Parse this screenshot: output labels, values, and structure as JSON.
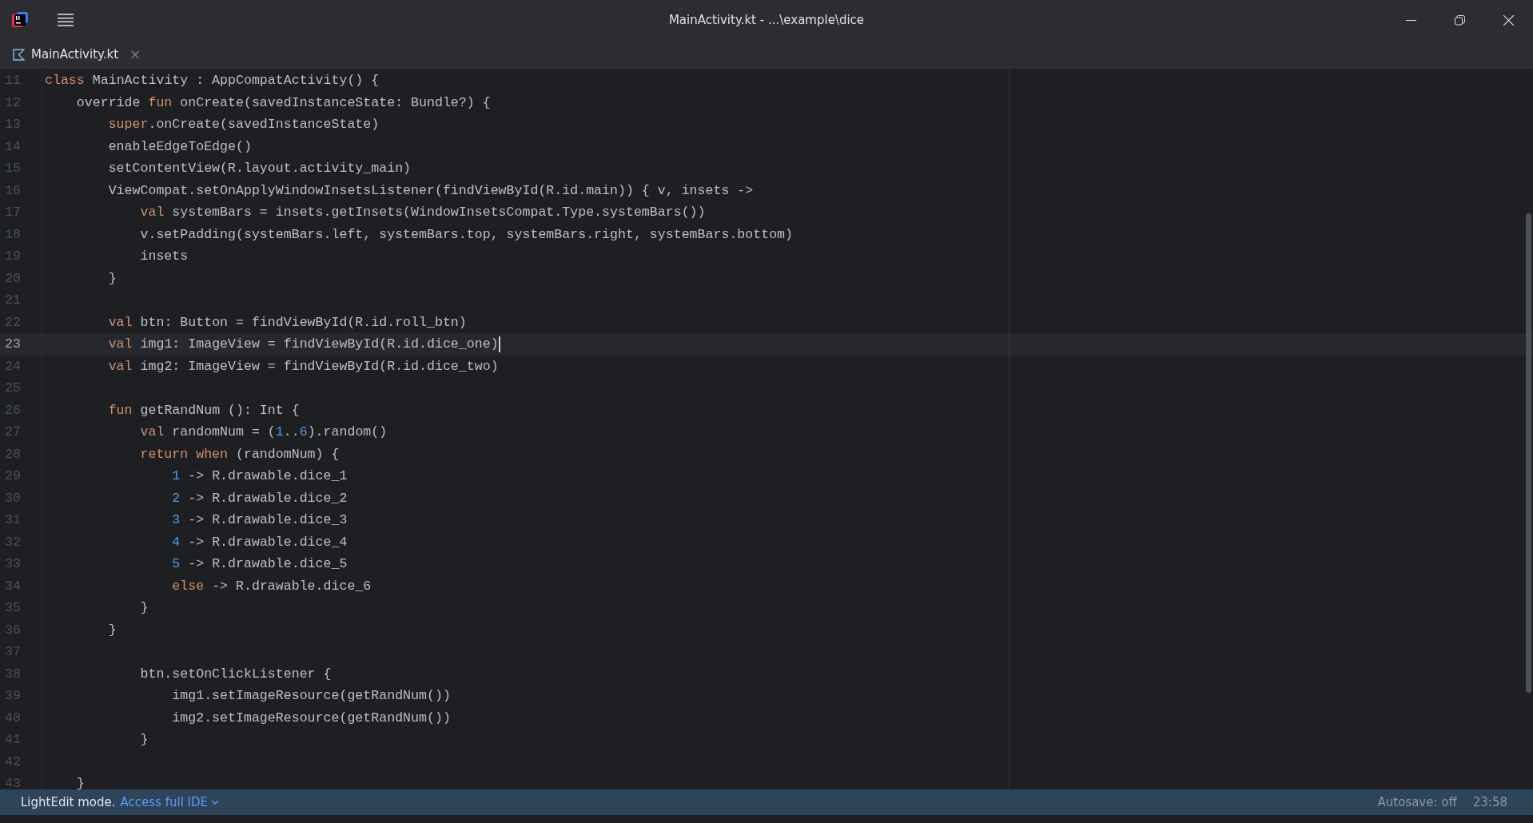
{
  "window": {
    "title": "MainActivity.kt - ...\\example\\dice"
  },
  "tabs": [
    {
      "label": "MainActivity.kt",
      "selected": true,
      "close": "×"
    }
  ],
  "editor": {
    "lines": [
      {
        "number": "11",
        "current": false,
        "tokens": [
          {
            "kind": "keyword",
            "text": "class"
          },
          {
            "kind": "plain",
            "text": " MainActivity : AppCompatActivity() {"
          }
        ]
      },
      {
        "number": "12",
        "current": false,
        "tokens": [
          {
            "kind": "plain",
            "text": "    override "
          },
          {
            "kind": "keyword",
            "text": "fun"
          },
          {
            "kind": "plain",
            "text": " onCreate(savedInstanceState: Bundle?) {"
          }
        ]
      },
      {
        "number": "13",
        "current": false,
        "tokens": [
          {
            "kind": "keyword",
            "text": "        super"
          },
          {
            "kind": "plain",
            "text": ".onCreate(savedInstanceState)"
          }
        ]
      },
      {
        "number": "14",
        "current": false,
        "tokens": [
          {
            "kind": "plain",
            "text": "        enableEdgeToEdge()"
          }
        ]
      },
      {
        "number": "15",
        "current": false,
        "tokens": [
          {
            "kind": "plain",
            "text": "        setContentView(R.layout.activity_main)"
          }
        ]
      },
      {
        "number": "16",
        "current": false,
        "tokens": [
          {
            "kind": "plain",
            "text": "        ViewCompat.setOnApplyWindowInsetsListener(findViewById(R.id.main)) { v, insets ->"
          }
        ]
      },
      {
        "number": "17",
        "current": false,
        "tokens": [
          {
            "kind": "keyword",
            "text": "            val"
          },
          {
            "kind": "plain",
            "text": " systemBars = insets.getInsets(WindowInsetsCompat.Type.systemBars())"
          }
        ]
      },
      {
        "number": "18",
        "current": false,
        "tokens": [
          {
            "kind": "plain",
            "text": "            v.setPadding(systemBars.left, systemBars.top, systemBars.right, systemBars.bottom)"
          }
        ]
      },
      {
        "number": "19",
        "current": false,
        "tokens": [
          {
            "kind": "plain",
            "text": "            insets"
          }
        ]
      },
      {
        "number": "20",
        "current": false,
        "tokens": [
          {
            "kind": "plain",
            "text": "        }"
          }
        ]
      },
      {
        "number": "21",
        "current": false
      },
      {
        "number": "22",
        "current": false,
        "tokens": [
          {
            "kind": "keyword",
            "text": "        val"
          },
          {
            "kind": "plain",
            "text": " btn: Button = findViewById(R.id.roll_btn)"
          }
        ]
      },
      {
        "number": "23",
        "current": true,
        "tokens": [
          {
            "kind": "keyword",
            "text": "        val"
          },
          {
            "kind": "plain",
            "text": " img1: ImageView = findViewById(R.id.dice_one)"
          }
        ]
      },
      {
        "number": "24",
        "current": false,
        "tokens": [
          {
            "kind": "keyword",
            "text": "        val"
          },
          {
            "kind": "plain",
            "text": " img2: ImageView = findViewById(R.id.dice_two)"
          }
        ]
      },
      {
        "number": "25",
        "current": false
      },
      {
        "number": "26",
        "current": false,
        "tokens": [
          {
            "kind": "keyword",
            "text": "        fun"
          },
          {
            "kind": "plain",
            "text": " getRandNum (): Int {"
          }
        ]
      },
      {
        "number": "27",
        "current": false,
        "tokens": [
          {
            "kind": "keyword",
            "text": "            val"
          },
          {
            "kind": "plain",
            "text": " randomNum = ("
          },
          {
            "kind": "number",
            "text": "1"
          },
          {
            "kind": "plain",
            "text": ".."
          },
          {
            "kind": "number",
            "text": "6"
          },
          {
            "kind": "plain",
            "text": ").random()"
          }
        ]
      },
      {
        "number": "28",
        "current": false,
        "tokens": [
          {
            "kind": "keyword",
            "text": "            return when"
          },
          {
            "kind": "plain",
            "text": " (randomNum) {"
          }
        ]
      },
      {
        "number": "29",
        "current": false,
        "tokens": [
          {
            "kind": "number",
            "text": "                1"
          },
          {
            "kind": "plain",
            "text": " -> R.drawable.dice_1"
          }
        ]
      },
      {
        "number": "30",
        "current": false,
        "tokens": [
          {
            "kind": "number",
            "text": "                2"
          },
          {
            "kind": "plain",
            "text": " -> R.drawable.dice_2"
          }
        ]
      },
      {
        "number": "31",
        "current": false,
        "tokens": [
          {
            "kind": "number",
            "text": "                3"
          },
          {
            "kind": "plain",
            "text": " -> R.drawable.dice_3"
          }
        ]
      },
      {
        "number": "32",
        "current": false,
        "tokens": [
          {
            "kind": "number",
            "text": "                4"
          },
          {
            "kind": "plain",
            "text": " -> R.drawable.dice_4"
          }
        ]
      },
      {
        "number": "33",
        "current": false,
        "tokens": [
          {
            "kind": "number",
            "text": "                5"
          },
          {
            "kind": "plain",
            "text": " -> R.drawable.dice_5"
          }
        ]
      },
      {
        "number": "34",
        "current": false,
        "tokens": [
          {
            "kind": "keyword",
            "text": "                else"
          },
          {
            "kind": "plain",
            "text": " -> R.drawable.dice_6"
          }
        ]
      },
      {
        "number": "35",
        "current": false,
        "tokens": [
          {
            "kind": "plain",
            "text": "            }"
          }
        ]
      },
      {
        "number": "36",
        "current": false,
        "tokens": [
          {
            "kind": "plain",
            "text": "        }"
          }
        ]
      },
      {
        "number": "37",
        "current": false
      },
      {
        "number": "38",
        "current": false,
        "tokens": [
          {
            "kind": "plain",
            "text": "            btn.setOnClickListener {"
          }
        ]
      },
      {
        "number": "39",
        "current": false,
        "tokens": [
          {
            "kind": "plain",
            "text": "                img1.setImageResource(getRandNum())"
          }
        ]
      },
      {
        "number": "40",
        "current": false,
        "tokens": [
          {
            "kind": "plain",
            "text": "                img2.setImageResource(getRandNum())"
          }
        ]
      },
      {
        "number": "41",
        "current": false,
        "tokens": [
          {
            "kind": "plain",
            "text": "            }"
          }
        ]
      },
      {
        "number": "42",
        "current": false
      },
      {
        "number": "43",
        "current": false,
        "tokens": [
          {
            "kind": "plain",
            "text": "    }"
          }
        ]
      }
    ]
  },
  "status_bar": {
    "mode": "LightEdit mode.",
    "link": "Access full IDE",
    "autosave": "Autosave: off",
    "time": "23:58"
  }
}
